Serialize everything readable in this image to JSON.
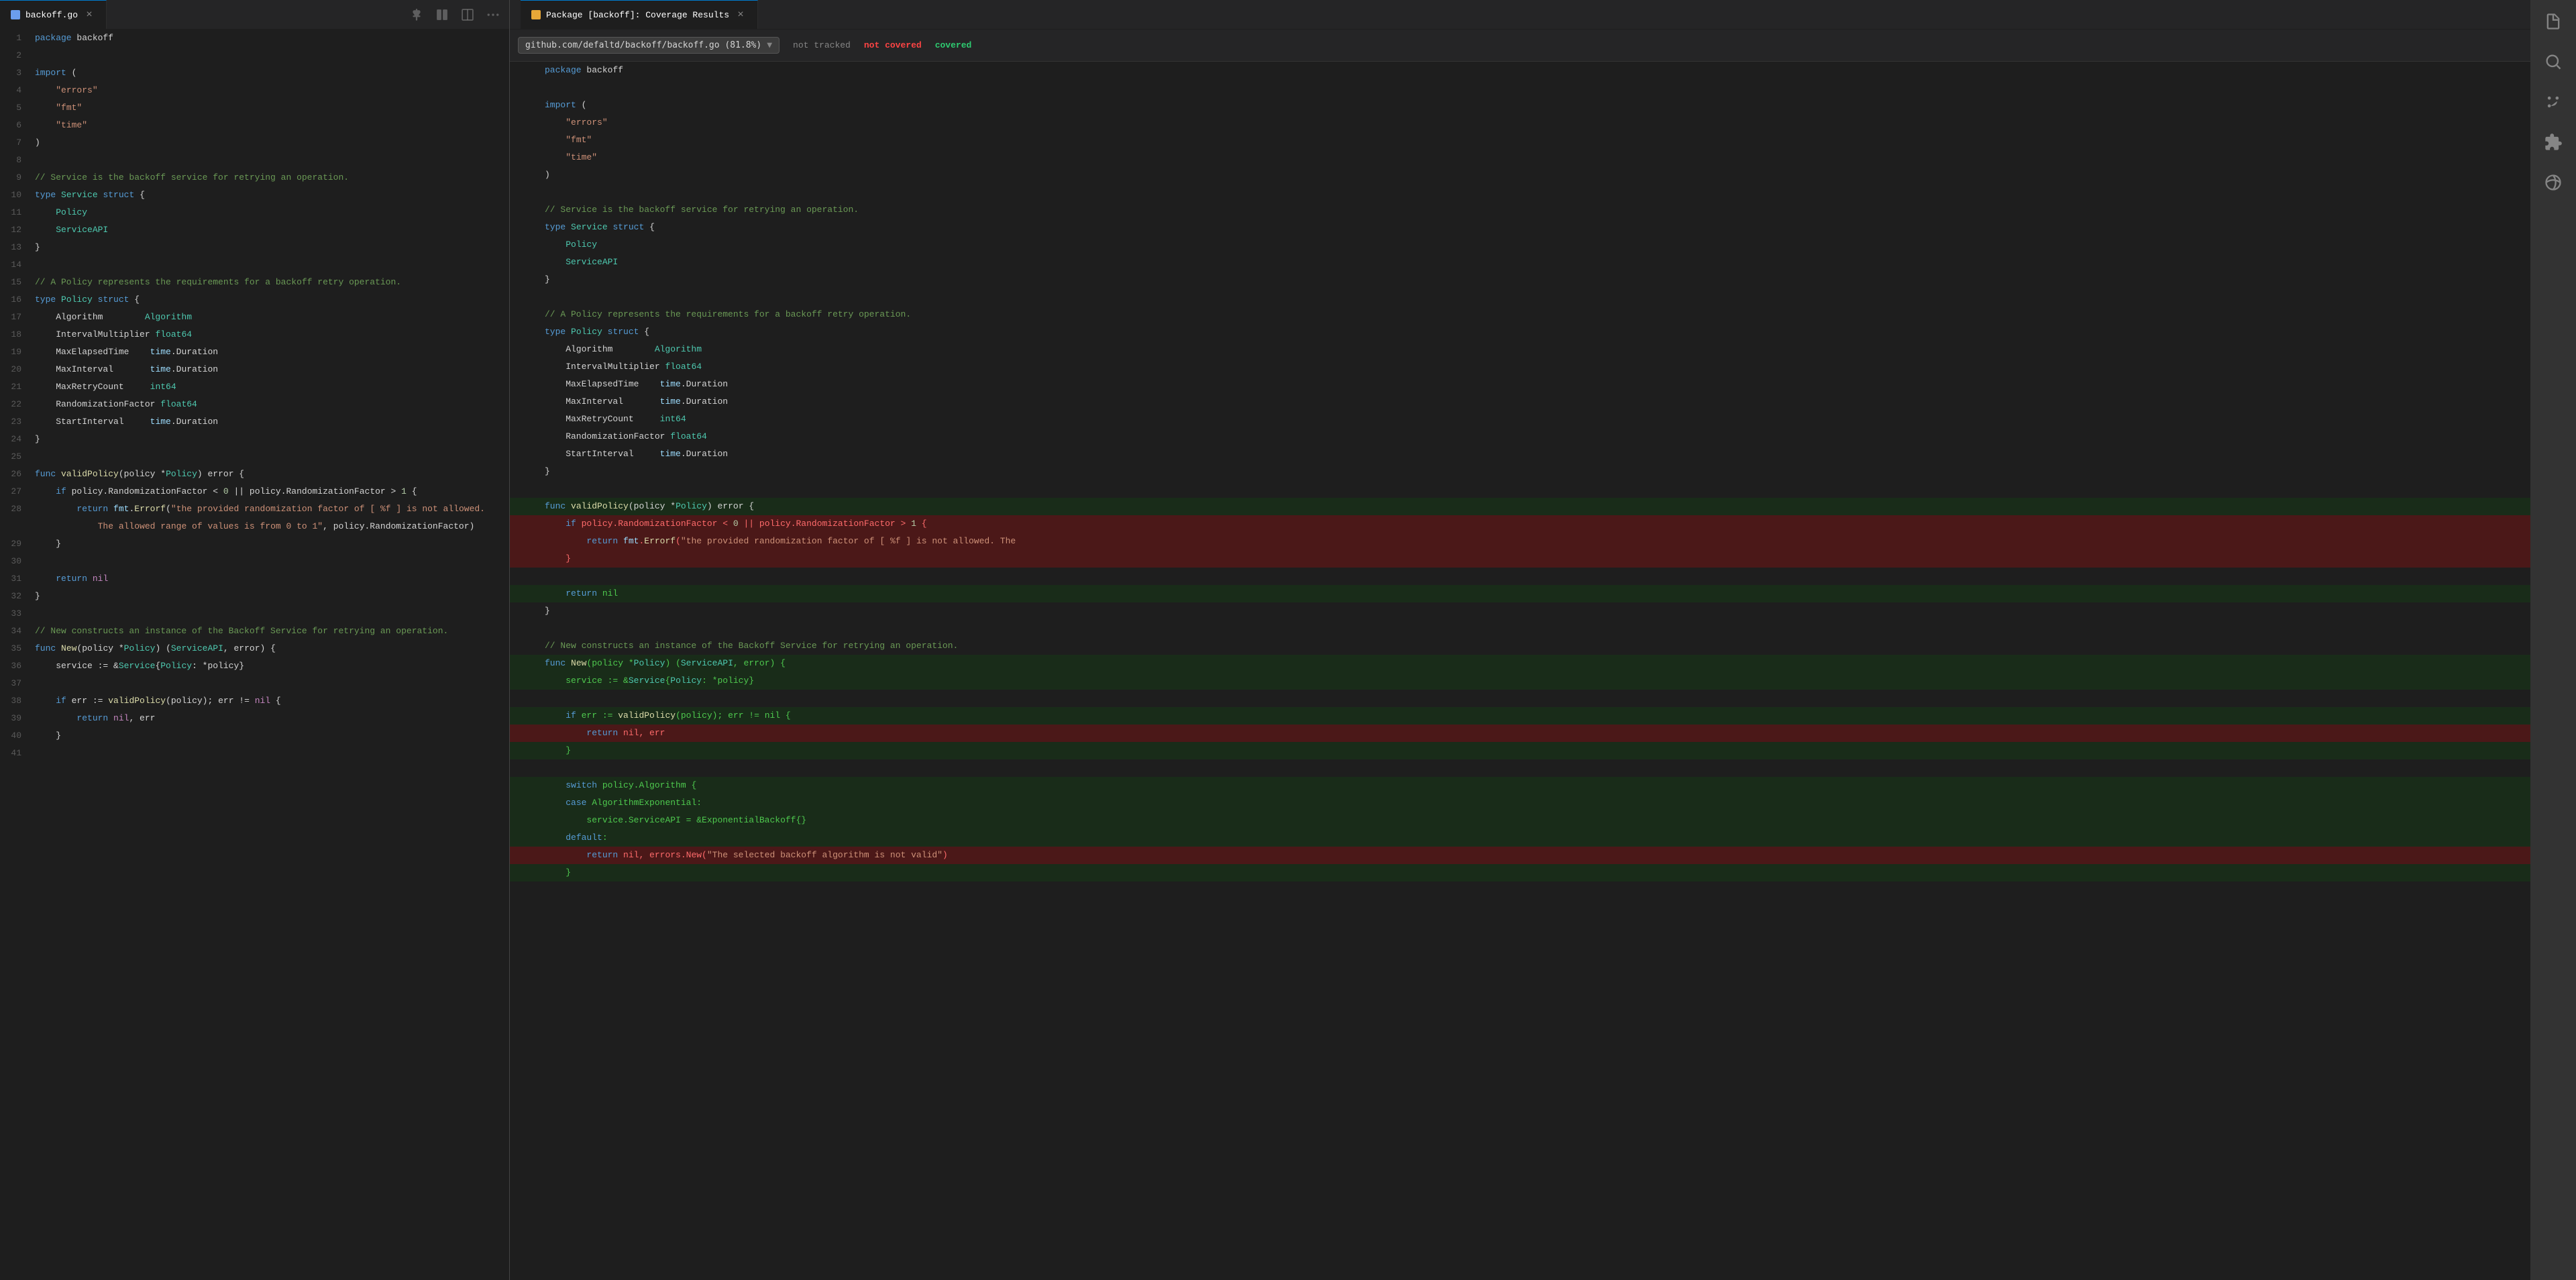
{
  "leftTab": {
    "filename": "backoff.go",
    "icon_color": "#6b9ded"
  },
  "rightTab": {
    "title": "Package [backoff]: Coverage Results"
  },
  "coverageToolbar": {
    "fileSelector": "github.com/defaltd/backoff/backoff.go (81.8%)",
    "legend": {
      "notTracked": "not tracked",
      "notCovered": "not covered",
      "covered": "covered"
    }
  },
  "activityIcons": [
    {
      "name": "files-icon",
      "symbol": "⎘"
    },
    {
      "name": "search-icon",
      "symbol": "🔍"
    },
    {
      "name": "source-control-icon",
      "symbol": "⎇"
    },
    {
      "name": "extensions-icon",
      "symbol": "⊞"
    },
    {
      "name": "remote-icon",
      "symbol": "🌐"
    }
  ],
  "leftEditorLines": [
    {
      "num": 1,
      "content": "package backoff",
      "type": "normal"
    },
    {
      "num": 2,
      "content": "",
      "type": "normal"
    },
    {
      "num": 3,
      "content": "import (",
      "type": "normal"
    },
    {
      "num": 4,
      "content": "\t\"errors\"",
      "type": "normal"
    },
    {
      "num": 5,
      "content": "\t\"fmt\"",
      "type": "normal"
    },
    {
      "num": 6,
      "content": "\t\"time\"",
      "type": "normal"
    },
    {
      "num": 7,
      "content": ")",
      "type": "normal"
    },
    {
      "num": 8,
      "content": "",
      "type": "normal"
    },
    {
      "num": 9,
      "content": "// Service is the backoff service for retrying an operation.",
      "type": "comment"
    },
    {
      "num": 10,
      "content": "type Service struct {",
      "type": "normal"
    },
    {
      "num": 11,
      "content": "\tPolicy",
      "type": "normal"
    },
    {
      "num": 12,
      "content": "\tServiceAPI",
      "type": "normal"
    },
    {
      "num": 13,
      "content": "}",
      "type": "normal"
    },
    {
      "num": 14,
      "content": "",
      "type": "normal"
    },
    {
      "num": 15,
      "content": "// A Policy represents the requirements for a backoff retry operation.",
      "type": "comment"
    },
    {
      "num": 16,
      "content": "type Policy struct {",
      "type": "normal"
    },
    {
      "num": 17,
      "content": "\tAlgorithm        Algorithm",
      "type": "normal"
    },
    {
      "num": 18,
      "content": "\tIntervalMultiplier float64",
      "type": "normal"
    },
    {
      "num": 19,
      "content": "\tMaxElapsedTime    time.Duration",
      "type": "normal"
    },
    {
      "num": 20,
      "content": "\tMaxInterval       time.Duration",
      "type": "normal"
    },
    {
      "num": 21,
      "content": "\tMaxRetryCount     int64",
      "type": "normal"
    },
    {
      "num": 22,
      "content": "\tRandomizationFactor float64",
      "type": "normal"
    },
    {
      "num": 23,
      "content": "\tStartInterval     time.Duration",
      "type": "normal"
    },
    {
      "num": 24,
      "content": "}",
      "type": "normal"
    },
    {
      "num": 25,
      "content": "",
      "type": "normal"
    },
    {
      "num": 26,
      "content": "func validPolicy(policy *Policy) error {",
      "type": "normal"
    },
    {
      "num": 27,
      "content": "\tif policy.RandomizationFactor < 0 || policy.RandomizationFactor > 1 {",
      "type": "normal"
    },
    {
      "num": 28,
      "content": "\t\treturn fmt.Errorf(\"the provided randomization factor of [ %f ] is not allowed.",
      "type": "normal"
    },
    {
      "num": 28,
      "content": "\t\t\tThe allowed range of values is from 0 to 1\", policy.RandomizationFactor)",
      "type": "normal"
    },
    {
      "num": 29,
      "content": "\t}",
      "type": "normal"
    },
    {
      "num": 30,
      "content": "",
      "type": "normal"
    },
    {
      "num": 31,
      "content": "\treturn nil",
      "type": "normal"
    },
    {
      "num": 32,
      "content": "}",
      "type": "normal"
    },
    {
      "num": 33,
      "content": "",
      "type": "normal"
    },
    {
      "num": 34,
      "content": "// New constructs an instance of the Backoff Service for retrying an operation.",
      "type": "comment"
    },
    {
      "num": 35,
      "content": "func New(policy *Policy) (ServiceAPI, error) {",
      "type": "normal"
    },
    {
      "num": 36,
      "content": "\tservice := &Service{Policy: *policy}",
      "type": "normal"
    },
    {
      "num": 37,
      "content": "",
      "type": "normal"
    },
    {
      "num": 38,
      "content": "\tif err := validPolicy(policy); err != nil {",
      "type": "normal"
    },
    {
      "num": 39,
      "content": "\t\treturn nil, err",
      "type": "normal"
    },
    {
      "num": 40,
      "content": "\t}",
      "type": "normal"
    },
    {
      "num": 41,
      "content": "",
      "type": "normal"
    }
  ]
}
